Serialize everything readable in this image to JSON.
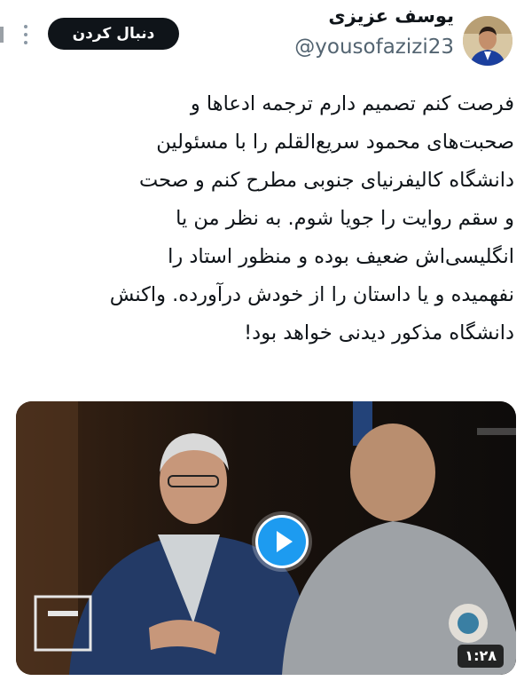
{
  "header": {
    "display_name": "یوسف عزیزی",
    "handle": "@yousofazizi23",
    "follow_label": "دنبال کردن"
  },
  "tweet": {
    "lines": [
      "فرصت کنم تصمیم دارم ترجمه ادعاها و",
      "صحبت‌های محمود سریع‌القلم را با مسئولین",
      "دانشگاه کالیفرنیای جنوبی مطرح کنم و صحت",
      "و سقم روایت را جویا شوم. به نظر من یا",
      "انگلیسی‌اش ضعیف بوده و منظور استاد را",
      "نفهمیده و یا داستان را از خودش درآورده. واکنش",
      "دانشگاه مذکور دیدنی خواهد بود!"
    ]
  },
  "media": {
    "duration": "۱:۲۸",
    "play_icon": "play-icon"
  },
  "colors": {
    "accent_blue": "#1d9bf0",
    "follow_bg": "#0f1419",
    "handle_gray": "#536471"
  }
}
